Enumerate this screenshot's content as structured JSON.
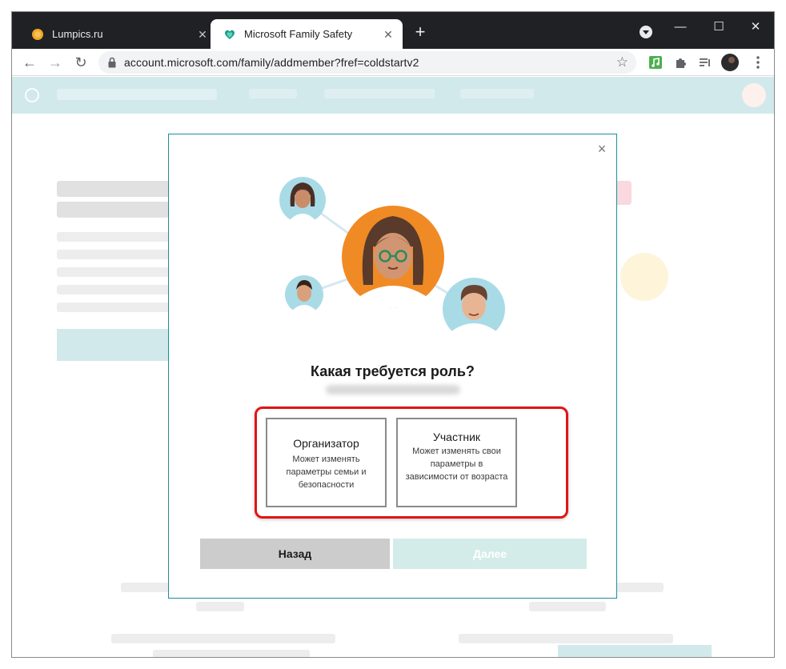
{
  "browser": {
    "tabs": [
      {
        "title": "Lumpics.ru",
        "active": false
      },
      {
        "title": "Microsoft Family Safety",
        "active": true
      }
    ],
    "url": "account.microsoft.com/family/addmember?fref=coldstartv2",
    "icons": {
      "back": "arrow-left-icon",
      "forward": "arrow-right-icon",
      "reload": "reload-icon",
      "bookmark": "star-icon",
      "extensions": [
        "music-extension-icon",
        "puzzle-extensions-icon",
        "reading-list-icon",
        "profile-avatar",
        "kebab-menu-icon"
      ]
    }
  },
  "modal": {
    "title": "Какая требуется роль?",
    "roles": [
      {
        "name": "Организатор",
        "description": "Может изменять параметры семьи и безопасности"
      },
      {
        "name": "Участник",
        "description": "Может изменять свои параметры в зависимости от возраста"
      }
    ],
    "back_label": "Назад",
    "next_label": "Далее"
  },
  "colors": {
    "accent": "#1a8f9c",
    "highlight": "#e11414",
    "back_button": "#cccccc",
    "next_button_disabled": "#d4ece9"
  }
}
